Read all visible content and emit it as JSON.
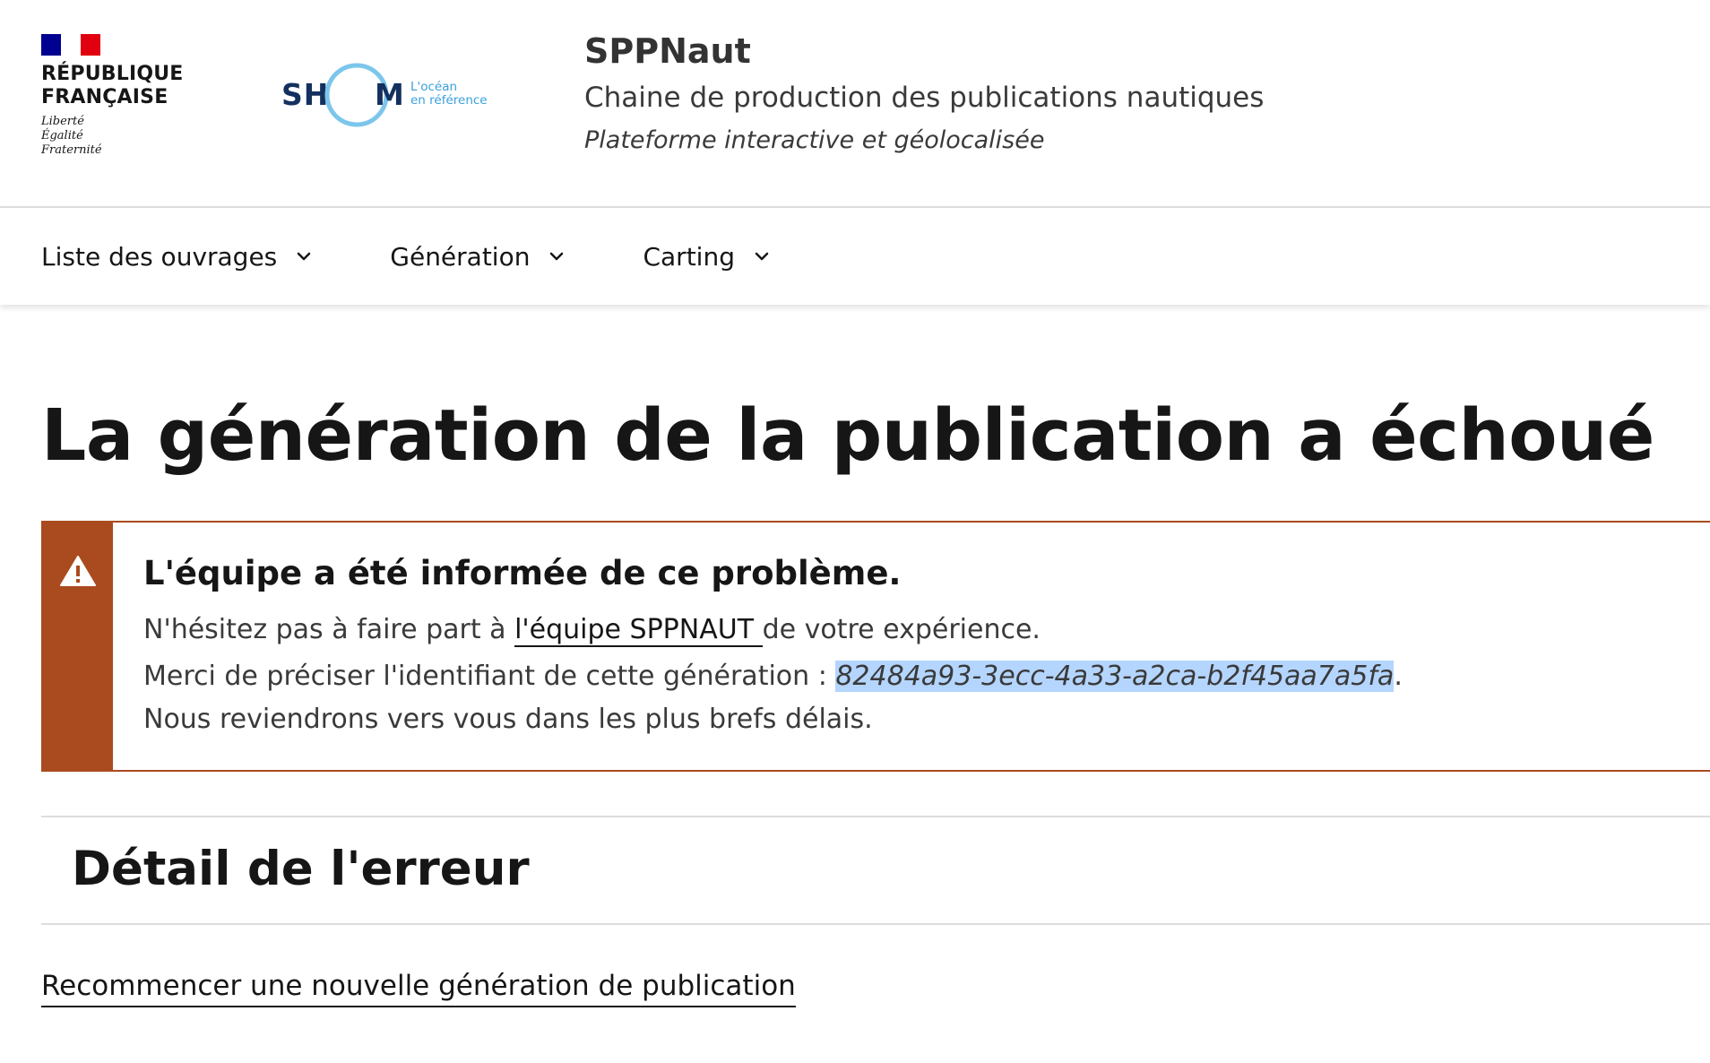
{
  "header": {
    "republique": "RÉPUBLIQUE\nFRANÇAISE",
    "devise": "Liberté\nÉgalité\nFraternité",
    "shom_sh": "SH",
    "shom_m": "M",
    "shom_tagline": "L'océan\nen référence",
    "service_title": "SPPNaut",
    "service_description": "Chaine de production des publications nautiques",
    "service_subtitle": "Plateforme interactive et géolocalisée"
  },
  "nav": {
    "items": [
      {
        "label": "Liste des ouvrages"
      },
      {
        "label": "Génération"
      },
      {
        "label": "Carting"
      }
    ]
  },
  "main": {
    "page_title": "La génération de la publication a échoué",
    "alert": {
      "title": "L'équipe a été informée de ce problème.",
      "line1_before": "N'hésitez pas à faire part à ",
      "line1_link": "l'équipe SPPNAUT ",
      "line1_after": "de votre expérience.",
      "line2_before": "Merci de préciser l'identifiant de cette génération : ",
      "generation_id": "82484a93-3ecc-4a33-a2ca-b2f45aa7a5fa",
      "line2_after": ".",
      "line3": "Nous reviendrons vers vous dans les plus brefs délais."
    },
    "detail_title": "Détail de l'erreur",
    "restart_link": "Recommencer une nouvelle génération de publication"
  },
  "icons": {
    "alert": "warning-icon",
    "nav_chevron": "chevron-down-icon"
  },
  "colors": {
    "alert_accent": "#a94b1f",
    "selection_highlight": "#b4d5fe",
    "republique_blue": "#000091",
    "republique_red": "#e1000f",
    "shom_navy": "#14305f",
    "shom_light_blue": "#3aa0dc"
  }
}
